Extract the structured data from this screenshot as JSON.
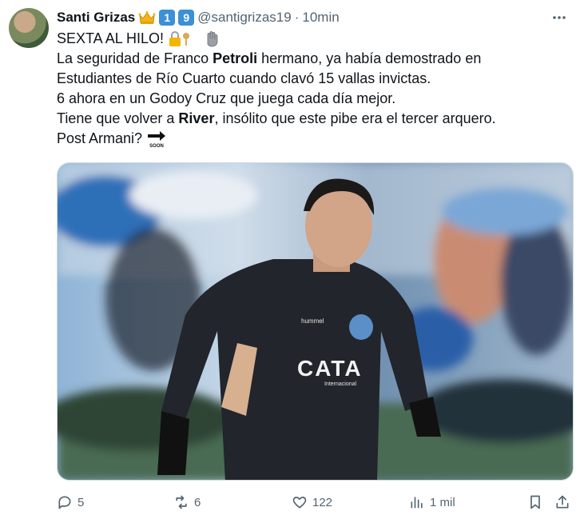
{
  "tweet": {
    "author_name": "Santi Grizas",
    "handle": "@santigrizas19",
    "separator": "·",
    "time": "10min",
    "badges": [
      "1",
      "9"
    ],
    "lines": {
      "l1": "SEXTA AL HILO!",
      "l2a": "La seguridad de Franco ",
      "l2b": "Petroli",
      "l2c": " hermano, ya había demostrado en",
      "l3": "Estudiantes de Río Cuarto cuando clavó 15 vallas invictas.",
      "l4": "6 ahora en un Godoy Cruz que juega cada día mejor.",
      "l5a": "Tiene que volver a ",
      "l5b": "River",
      "l5c": ", insólito que este pibe era el tercer arquero.",
      "l6": "Post Armani?"
    },
    "soon_label": "SOON",
    "jersey_sponsor": "CATA",
    "jersey_sub": "Internacional",
    "jersey_brand": "hummel"
  },
  "actions": {
    "replies": "5",
    "reposts": "6",
    "likes": "122",
    "views": "1 mil"
  },
  "icons": [
    "more-icon",
    "crown-icon",
    "lock-key-icon",
    "hand-icon",
    "soon-arrow-icon",
    "reply-icon",
    "repost-icon",
    "like-icon",
    "views-icon",
    "bookmark-icon",
    "share-icon"
  ],
  "colors": {
    "text": "#0f1419",
    "muted": "#536471",
    "badge": "#3d8fd6",
    "jersey": "#22252b"
  }
}
